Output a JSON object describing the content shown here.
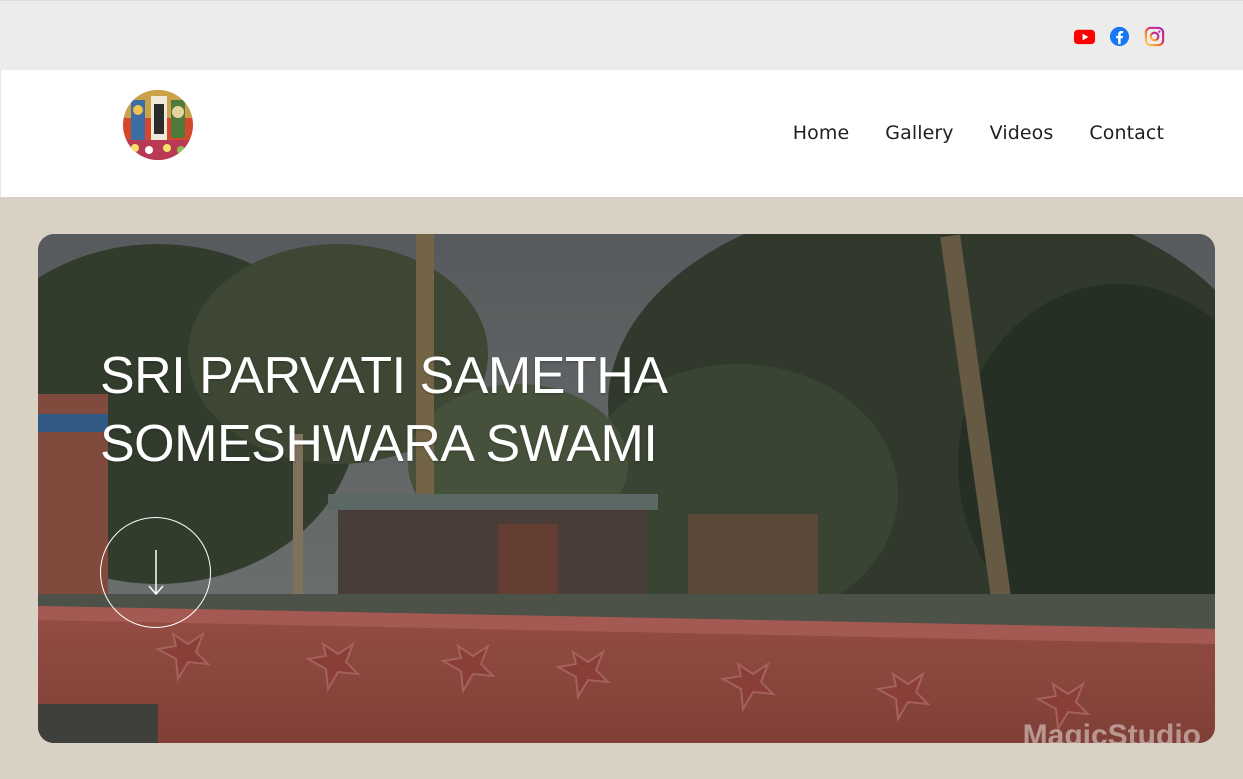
{
  "social": {
    "youtube": {
      "icon": "youtube-icon",
      "color": "#ff0000"
    },
    "facebook": {
      "icon": "facebook-icon",
      "color": "#1877f2"
    },
    "instagram": {
      "icon": "instagram-icon",
      "color": "#d62976"
    }
  },
  "header": {
    "logo_icon": "temple-deity-logo",
    "nav": [
      {
        "label": "Home"
      },
      {
        "label": "Gallery"
      },
      {
        "label": "Videos"
      },
      {
        "label": "Contact"
      }
    ]
  },
  "hero": {
    "title_line1": "SRI PARVATI SAMETHA",
    "title_line2": "SOMESHWARA SWAMI",
    "scroll_icon": "arrow-down-icon",
    "watermark": "MagicStudio"
  },
  "colors": {
    "page_bg": "#d8d1c4",
    "topbar_bg": "#ececec",
    "header_bg": "#ffffff",
    "nav_text": "#1f1f1f"
  }
}
